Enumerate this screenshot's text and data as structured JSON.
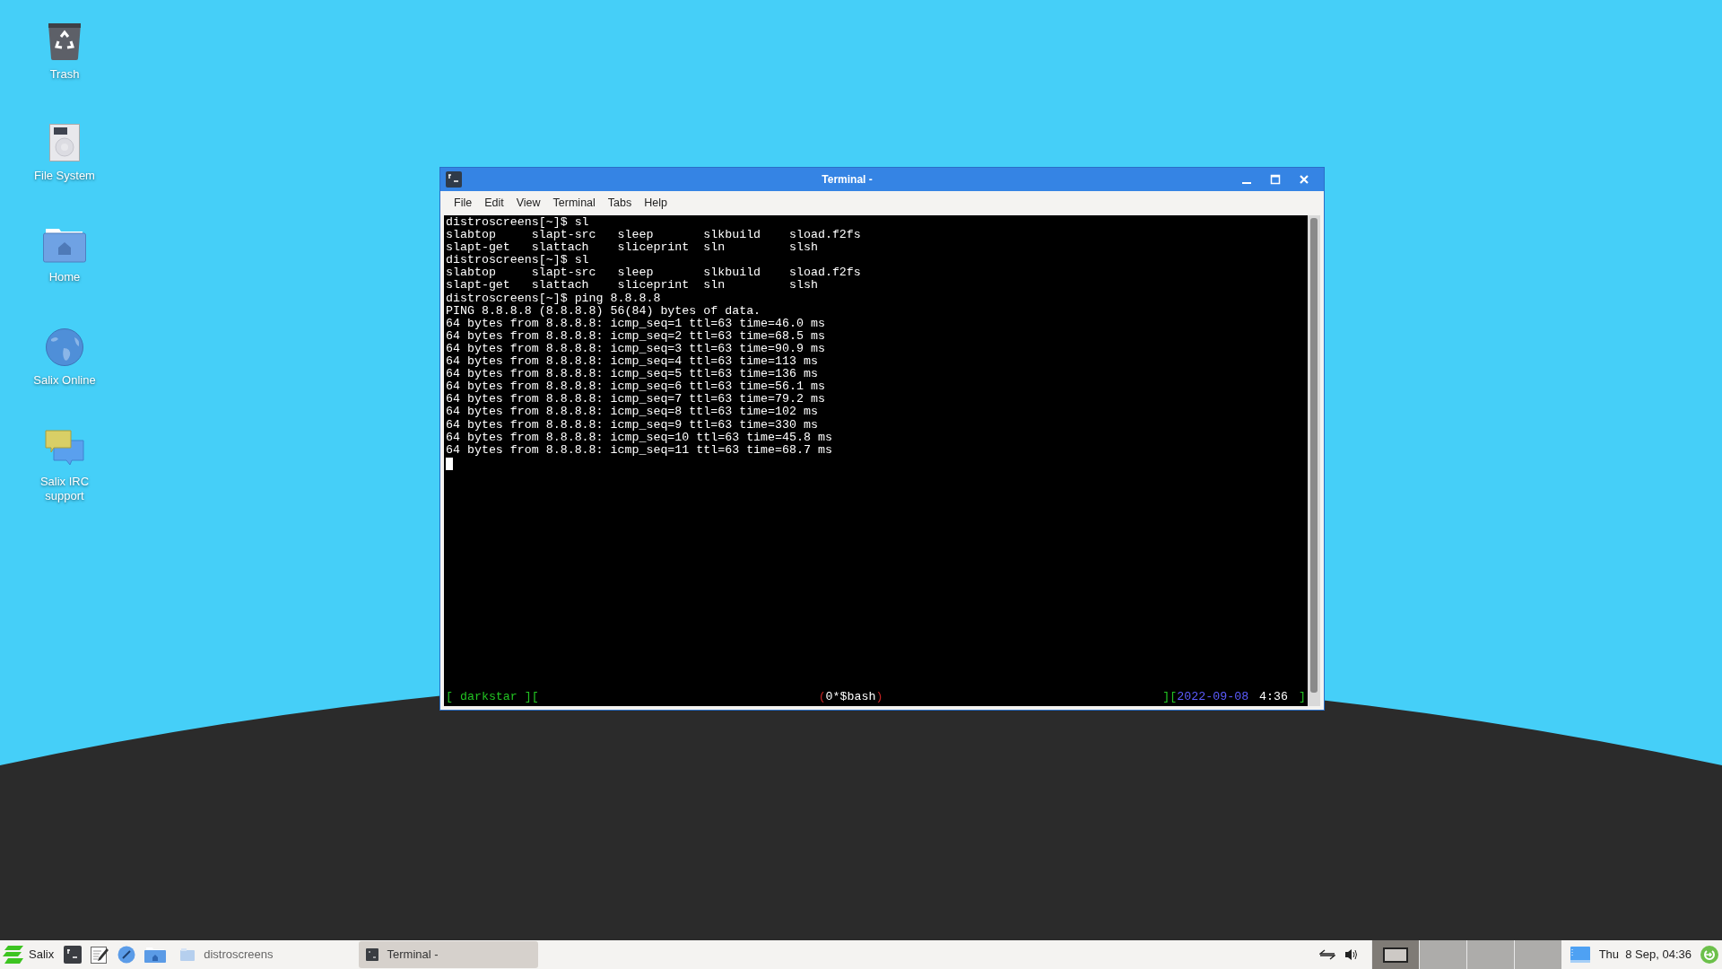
{
  "desktop_icons": [
    {
      "kind": "trash",
      "label": "Trash"
    },
    {
      "kind": "drive",
      "label": "File System"
    },
    {
      "kind": "home",
      "label": "Home"
    },
    {
      "kind": "globe",
      "label": "Salix Online"
    },
    {
      "kind": "chat",
      "label": "Salix IRC support"
    }
  ],
  "window": {
    "title": "Terminal -",
    "menu": [
      "File",
      "Edit",
      "View",
      "Terminal",
      "Tabs",
      "Help"
    ],
    "lines": [
      "distroscreens[~]$ sl",
      "slabtop     slapt-src   sleep       slkbuild    sload.f2fs",
      "slapt-get   slattach    sliceprint  sln         slsh",
      "distroscreens[~]$ sl",
      "slabtop     slapt-src   sleep       slkbuild    sload.f2fs",
      "slapt-get   slattach    sliceprint  sln         slsh",
      "distroscreens[~]$ ping 8.8.8.8",
      "PING 8.8.8.8 (8.8.8.8) 56(84) bytes of data.",
      "64 bytes from 8.8.8.8: icmp_seq=1 ttl=63 time=46.0 ms",
      "64 bytes from 8.8.8.8: icmp_seq=2 ttl=63 time=68.5 ms",
      "64 bytes from 8.8.8.8: icmp_seq=3 ttl=63 time=90.9 ms",
      "64 bytes from 8.8.8.8: icmp_seq=4 ttl=63 time=113 ms",
      "64 bytes from 8.8.8.8: icmp_seq=5 ttl=63 time=136 ms",
      "64 bytes from 8.8.8.8: icmp_seq=6 ttl=63 time=56.1 ms",
      "64 bytes from 8.8.8.8: icmp_seq=7 ttl=63 time=79.2 ms",
      "64 bytes from 8.8.8.8: icmp_seq=8 ttl=63 time=102 ms",
      "64 bytes from 8.8.8.8: icmp_seq=9 ttl=63 time=330 ms",
      "64 bytes from 8.8.8.8: icmp_seq=10 ttl=63 time=45.8 ms",
      "64 bytes from 8.8.8.8: icmp_seq=11 ttl=63 time=68.7 ms"
    ],
    "status_line": {
      "left": [
        {
          "text": "[ darkstar ][",
          "color": "#22c422"
        }
      ],
      "center": [
        {
          "text": "(",
          "color": "#c42222"
        },
        {
          "text": "0*$bash",
          "color": "#ffffff"
        },
        {
          "text": ")",
          "color": "#c42222"
        }
      ],
      "right": [
        {
          "text": "][",
          "color": "#22c422"
        },
        {
          "text": "2022-09-08",
          "color": "#5c5cff"
        },
        {
          "text": "4:36",
          "color": "#ffffff"
        },
        {
          "text": "]",
          "color": "#22c422"
        }
      ]
    }
  },
  "taskbar": {
    "menu_label": "Salix",
    "launchers": [
      {
        "kind": "terminal"
      },
      {
        "kind": "editor"
      },
      {
        "kind": "compass"
      },
      {
        "kind": "home"
      }
    ],
    "places_label": "distroscreens",
    "tasks": [
      {
        "label": "Terminal -",
        "selected": true
      }
    ],
    "workspaces": [
      {
        "selected": true
      },
      {
        "selected": false
      },
      {
        "selected": false
      },
      {
        "selected": false
      }
    ],
    "clock": "Thu  8 Sep, 04:36"
  }
}
